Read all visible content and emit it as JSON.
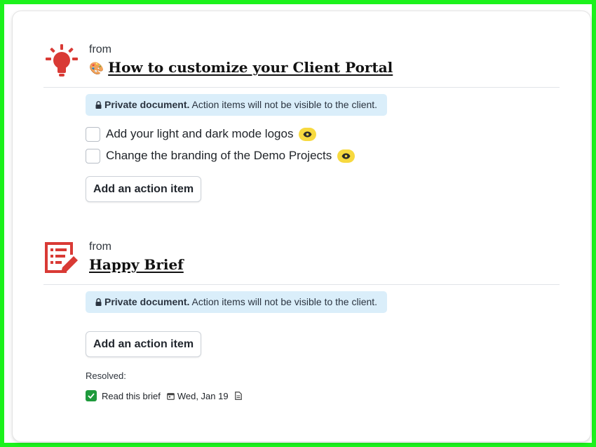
{
  "colors": {
    "accent_red": "#d93a35",
    "notice_bg": "#daeefa",
    "eye_badge": "#f7d93f",
    "resolved_check": "#1e9a3c"
  },
  "sections": [
    {
      "icon": "lightbulb-icon",
      "from_label": "from",
      "title_emoji": "🎨",
      "title": "How to customize your Client Portal",
      "notice": {
        "strong": "Private document.",
        "text": " Action items will not be visible to the client."
      },
      "action_items": [
        {
          "text": "Add your light and dark mode logos",
          "checked": false,
          "visible_icon": "eye-icon"
        },
        {
          "text": "Change the branding of the Demo Projects",
          "checked": false,
          "visible_icon": "eye-icon"
        }
      ],
      "add_button": "Add an action item"
    },
    {
      "icon": "brief-edit-icon",
      "from_label": "from",
      "title": "Happy Brief",
      "notice": {
        "strong": "Private document.",
        "text": " Action items will not be visible to the client."
      },
      "add_button": "Add an action item",
      "resolved_label": "Resolved:",
      "resolved_items": [
        {
          "text": "Read this brief",
          "date": "Wed, Jan 19",
          "checked": true
        }
      ]
    }
  ]
}
